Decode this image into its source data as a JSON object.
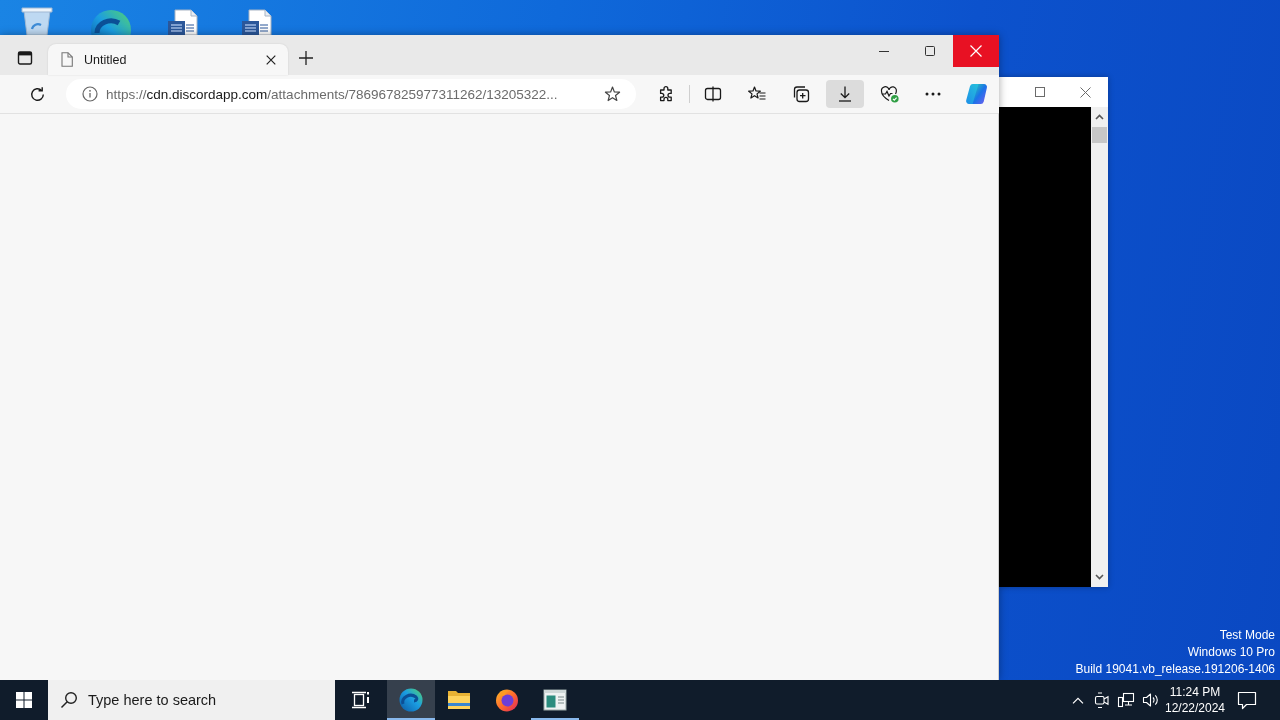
{
  "desktop": {
    "system_text": [
      "Test Mode",
      "Windows 10 Pro",
      "Build 19041.vb_release.191206-1406"
    ]
  },
  "browser": {
    "tabs": [
      {
        "title": "Untitled",
        "selected": true
      }
    ],
    "window_controls": [
      {
        "kind": "minimize",
        "hovered": false
      },
      {
        "kind": "maximize",
        "hovered": false
      },
      {
        "kind": "close",
        "hovered": true
      }
    ],
    "address_bar": {
      "scheme": "https://",
      "host": "cdn.discordapp.com",
      "path": "/attachments/786967825977311262/13205322..."
    },
    "toolbar_buttons": [
      {
        "kind": "extensions",
        "pressed": false
      },
      {
        "kind": "split-screen",
        "pressed": false
      },
      {
        "kind": "favorites",
        "pressed": false
      },
      {
        "kind": "collections",
        "pressed": false
      },
      {
        "kind": "downloads",
        "pressed": true
      },
      {
        "kind": "essentials",
        "pressed": false
      },
      {
        "kind": "more",
        "pressed": false
      },
      {
        "kind": "copilot",
        "pressed": false
      }
    ]
  },
  "taskbar": {
    "search": {
      "placeholder": "Type here to search"
    },
    "apps": [
      {
        "kind": "edge",
        "active": true,
        "running": true
      },
      {
        "kind": "explorer",
        "active": false,
        "running": false
      },
      {
        "kind": "firefox",
        "active": false,
        "running": false
      },
      {
        "kind": "console",
        "active": false,
        "running": true
      }
    ],
    "clock": {
      "time": "11:24 PM",
      "date": "12/22/2024"
    }
  }
}
